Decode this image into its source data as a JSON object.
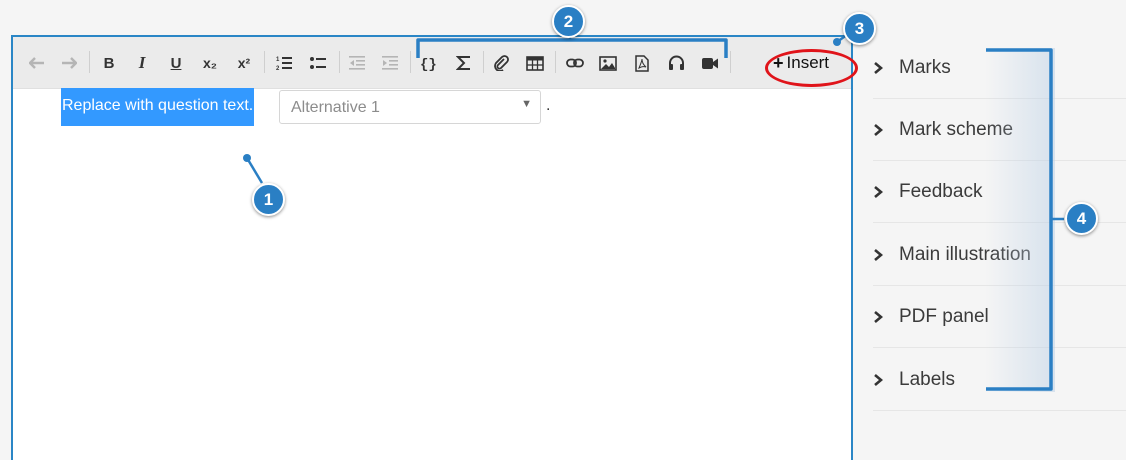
{
  "toolbar": {
    "buttons": [
      {
        "name": "undo-button",
        "icon": "undo-icon",
        "glyph": "↶"
      },
      {
        "name": "redo-button",
        "icon": "redo-icon",
        "glyph": "↷"
      },
      {
        "name": "bold-button",
        "icon": "bold-icon",
        "glyph": "B"
      },
      {
        "name": "italic-button",
        "icon": "italic-icon",
        "glyph": "I"
      },
      {
        "name": "underline-button",
        "icon": "underline-icon",
        "glyph": "U"
      },
      {
        "name": "subscript-button",
        "icon": "subscript-icon",
        "glyph": "x₂"
      },
      {
        "name": "superscript-button",
        "icon": "superscript-icon",
        "glyph": "x²"
      }
    ],
    "insert_label": "Insert",
    "insert_plus": "+"
  },
  "editor": {
    "question_text": "Replace with question text.",
    "dropdown_value": "Alternative 1",
    "trailing_text": "."
  },
  "sidebar": {
    "items": [
      {
        "label": "Marks"
      },
      {
        "label": "Mark scheme"
      },
      {
        "label": "Feedback"
      },
      {
        "label": "Main illustration"
      },
      {
        "label": "PDF panel"
      },
      {
        "label": "Labels"
      }
    ]
  },
  "annotations": {
    "badge_1": "1",
    "badge_2": "2",
    "badge_3": "3",
    "badge_4": "4"
  },
  "colors": {
    "accent": "#2a86c6",
    "highlight": "#3399ff",
    "annotation": "#2a7fc4",
    "oval": "#e0141a"
  }
}
